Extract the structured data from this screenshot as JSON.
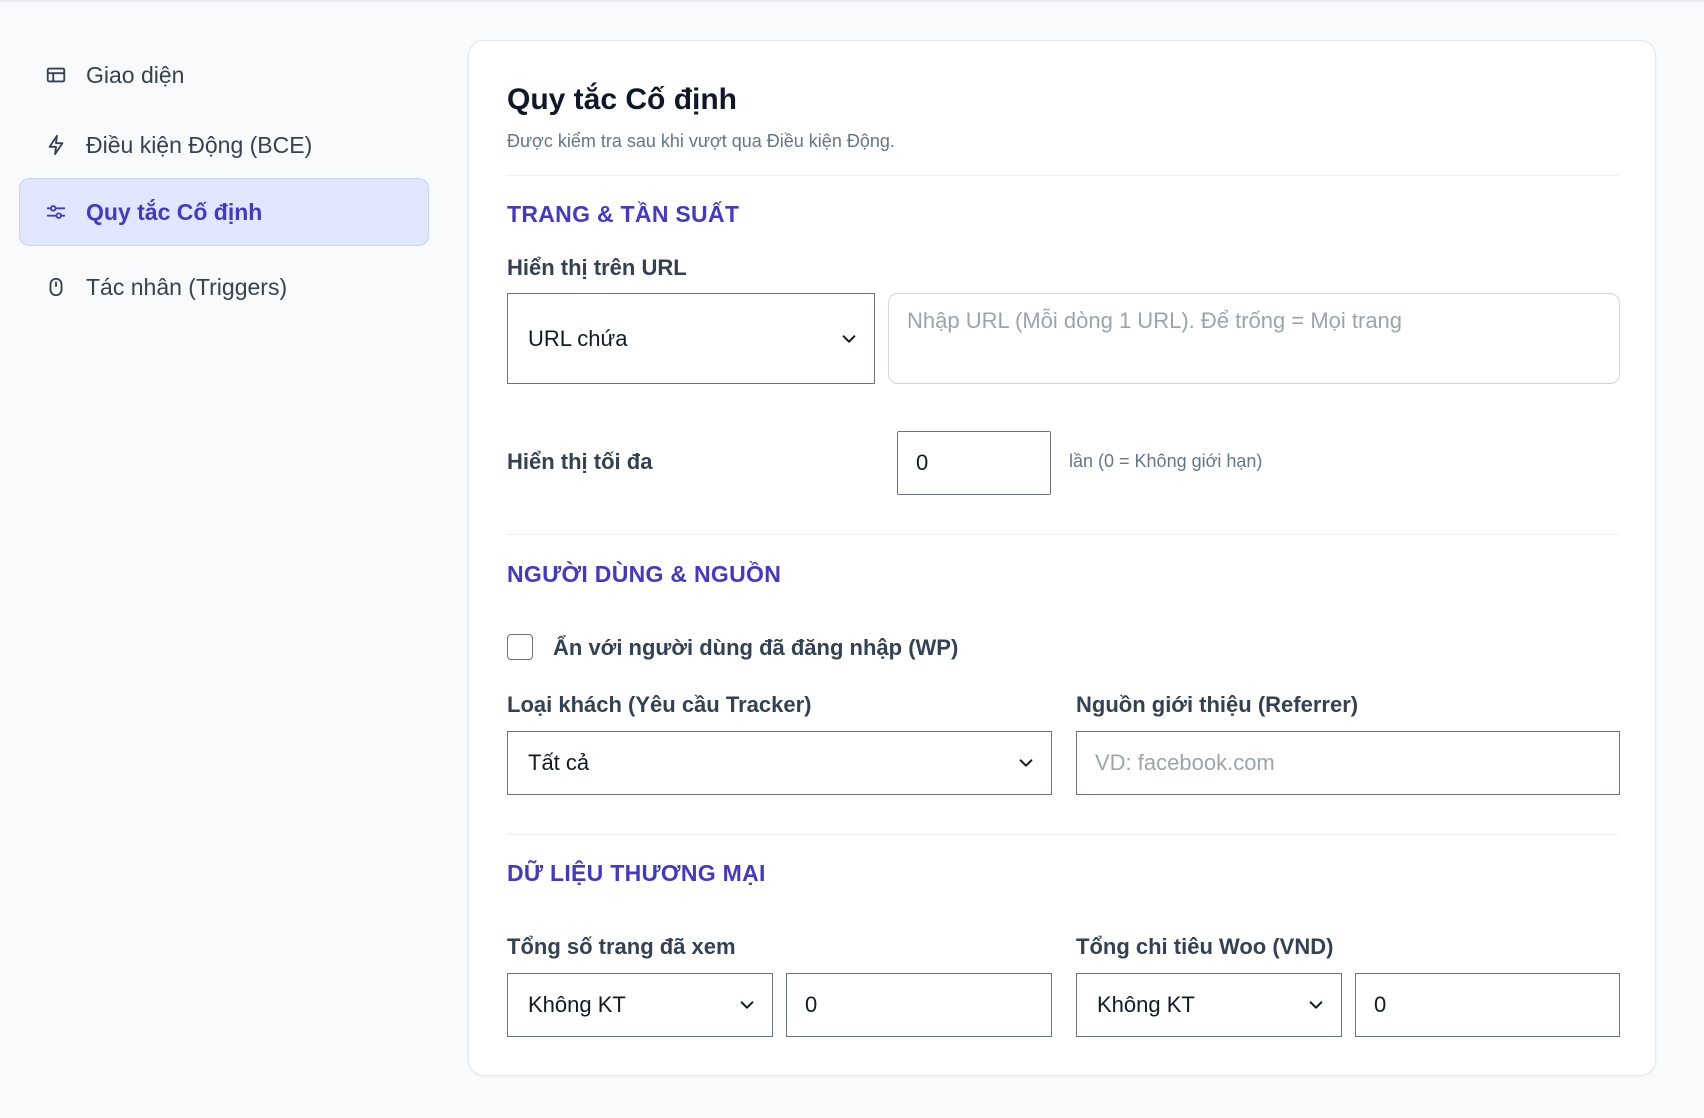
{
  "sidebar": {
    "items": [
      {
        "label": "Giao diện",
        "icon": "layout-icon",
        "active": false
      },
      {
        "label": "Điều kiện Động (BCE)",
        "icon": "lightning-icon",
        "active": false
      },
      {
        "label": "Quy tắc Cố định",
        "icon": "sliders-icon",
        "active": true
      },
      {
        "label": "Tác nhân (Triggers)",
        "icon": "mouse-icon",
        "active": false
      }
    ]
  },
  "colors": {
    "accent": "#4338ca",
    "active_bg": "#e0e7ff"
  },
  "main": {
    "title": "Quy tắc Cố định",
    "subtitle": "Được kiểm tra sau khi vượt qua Điều kiện Động.",
    "sections": {
      "page_frequency": {
        "heading": "TRANG & TẦN SUẤT",
        "url_label": "Hiển thị trên URL",
        "url_match": "URL chứa",
        "url_placeholder": "Nhập URL (Mỗi dòng 1 URL). Để trống = Mọi trang",
        "url_value": "",
        "max_label": "Hiển thị tối đa",
        "max_value": "0",
        "max_hint": "lần (0 = Không giới hạn)"
      },
      "user_source": {
        "heading": "NGƯỜI DÙNG & NGUỒN",
        "hide_logged_in_label": "Ẩn với người dùng đã đăng nhập (WP)",
        "hide_logged_in_checked": false,
        "visitor_type_label": "Loại khách (Yêu cầu Tracker)",
        "visitor_type_value": "Tất cả",
        "referrer_label": "Nguồn giới thiệu (Referrer)",
        "referrer_placeholder": "VD: facebook.com",
        "referrer_value": ""
      },
      "commerce": {
        "heading": "DỮ LIỆU THƯƠNG MẠI",
        "pages_viewed_label": "Tổng số trang đã xem",
        "pages_viewed_operator": "Không KT",
        "pages_viewed_value": "0",
        "woo_spend_label": "Tổng chi tiêu Woo (VND)",
        "woo_spend_operator": "Không KT",
        "woo_spend_value": "0"
      }
    }
  }
}
